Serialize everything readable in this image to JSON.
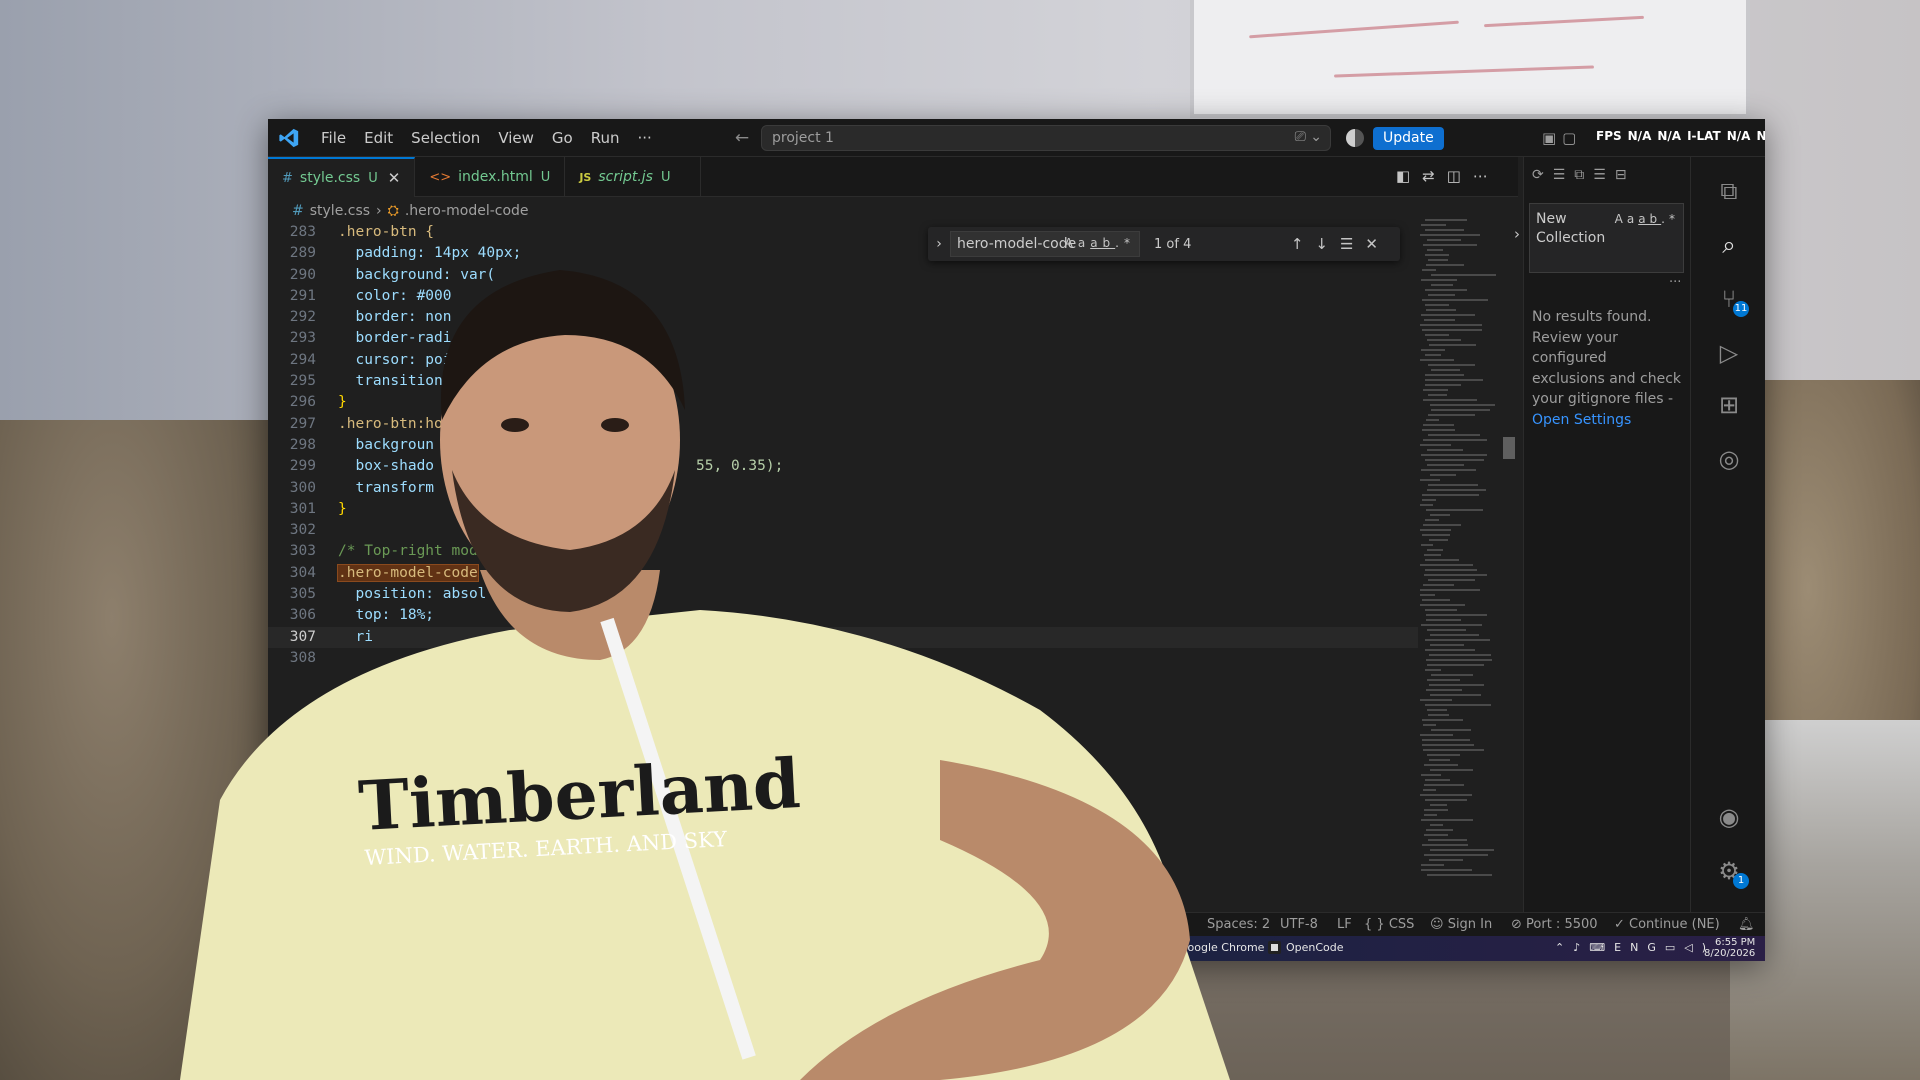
{
  "window": {
    "menu": [
      "File",
      "Edit",
      "Selection",
      "View",
      "Go",
      "Run",
      "···"
    ],
    "command_center": "project 1",
    "update_label": "Update",
    "fps_overlay": [
      "FPS",
      "N/A",
      "N/A",
      "I-LAT",
      "N/A",
      "N/A"
    ]
  },
  "tabs": [
    {
      "icon": "#",
      "name": "style.css",
      "badge": "U",
      "active": true
    },
    {
      "icon": "<>",
      "name": "index.html",
      "badge": "U",
      "active": false
    },
    {
      "icon": "JS",
      "name": "script.js",
      "badge": "U",
      "active": false
    }
  ],
  "breadcrumb": {
    "file": "style.css",
    "symbol": ".hero-model-code"
  },
  "find": {
    "query": "hero-model-code",
    "opt_case": "Aa",
    "opt_word": "ab",
    "opt_regex": ".*",
    "count": "1 of 4"
  },
  "code_lines": [
    {
      "n": "283",
      "text": ".hero-btn {"
    },
    {
      "n": "289",
      "text": "  padding: 14px 40px;"
    },
    {
      "n": "290",
      "text": "  background: var("
    },
    {
      "n": "291",
      "text": "  color: #000"
    },
    {
      "n": "292",
      "text": "  border: non"
    },
    {
      "n": "293",
      "text": "  border-radi"
    },
    {
      "n": "294",
      "text": "  cursor: poi"
    },
    {
      "n": "295",
      "text": "  transition:"
    },
    {
      "n": "296",
      "text": "}"
    },
    {
      "n": "297",
      "text": ".hero-btn:hov"
    },
    {
      "n": "298",
      "text": "  backgroun"
    },
    {
      "n": "299",
      "text": "  box-shado"
    },
    {
      "n": "300",
      "text": "  transform"
    },
    {
      "n": "301",
      "text": "}"
    },
    {
      "n": "302",
      "text": ""
    },
    {
      "n": "303",
      "text": "/* Top-right mode"
    },
    {
      "n": "304",
      "text": ".hero-model-code"
    },
    {
      "n": "305",
      "text": "  position: absol"
    },
    {
      "n": "306",
      "text": "  top: 18%;"
    },
    {
      "n": "307",
      "text": "  ri"
    },
    {
      "n": "308",
      "text": ""
    }
  ],
  "code_fragment_299": "55, 0.35);",
  "side_panel": {
    "input": "New Collection",
    "input_opts": [
      "Aa",
      "ab",
      ".*"
    ],
    "message": "No results found. Review your configured exclusions and check your gitignore files - ",
    "link": "Open Settings"
  },
  "activity_badges": {
    "source_control": "11",
    "settings": "1"
  },
  "status": {
    "spaces": "Spaces: 2",
    "encoding": "UTF-8",
    "eol": "LF",
    "language": "CSS",
    "sign_in": "Sign In",
    "port": "Port : 5500",
    "continue": "Continue (NE)"
  },
  "taskbar": {
    "apps": [
      "Google Chrome",
      "OpenCode"
    ],
    "lang": "ENG",
    "time": "6:55 PM",
    "date": "8/20/2026"
  },
  "colors": {
    "accent": "#0078d4",
    "update": "#0e6fd0",
    "modified": "#73c991",
    "link": "#3794ff"
  },
  "branding": {
    "shirt_text": "Timberland",
    "shirt_tagline": "WIND. WATER. EARTH. AND SKY"
  }
}
